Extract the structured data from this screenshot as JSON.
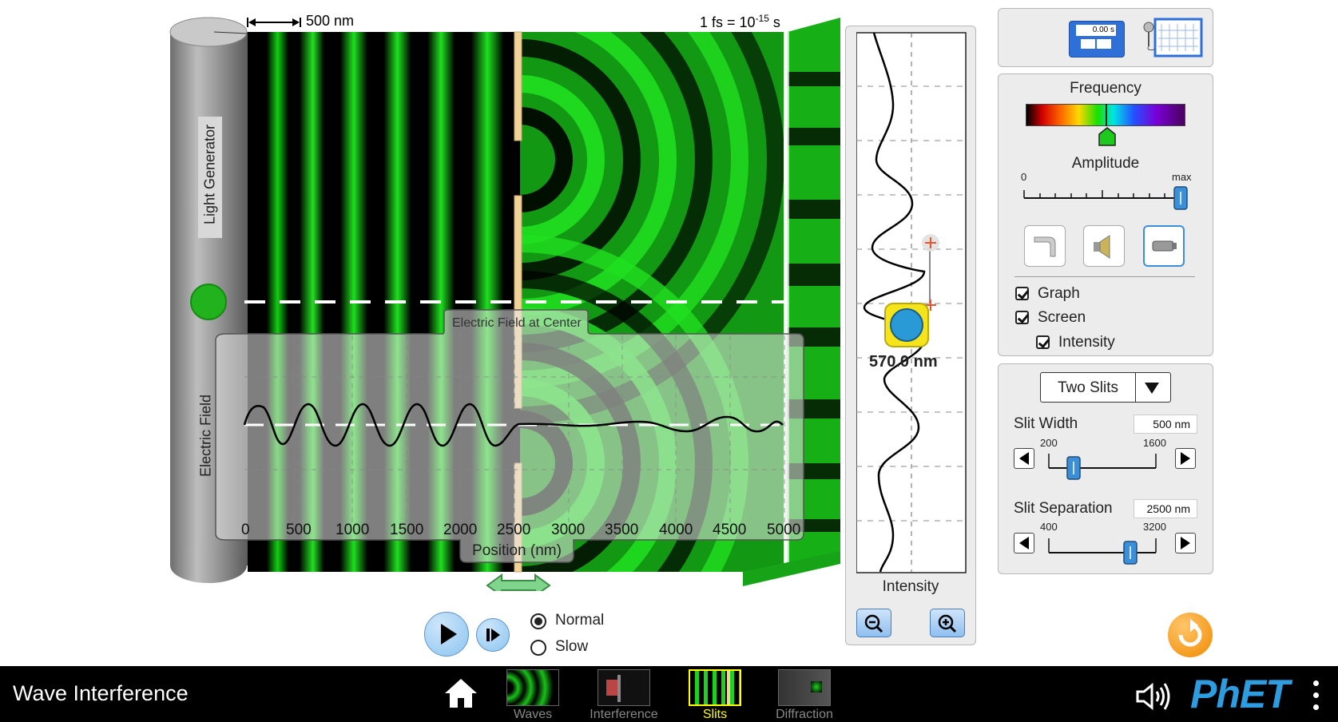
{
  "scale": {
    "length": "500 nm",
    "time_prefix": "1 fs = 10",
    "time_exp": "-15",
    "time_unit": " s"
  },
  "light_generator": {
    "label": "Light Generator"
  },
  "efield_chart": {
    "title": "Electric Field at Center",
    "ylabel": "Electric Field",
    "xlabel": "Position (nm)",
    "ticks": [
      "0",
      "500",
      "1000",
      "1500",
      "2000",
      "2500",
      "3000",
      "3500",
      "4000",
      "4500",
      "5000"
    ]
  },
  "intensity": {
    "label": "Intensity",
    "tape": "570.0 nm"
  },
  "tools": {
    "stopwatch_text": "0.00 s"
  },
  "frequency_panel": {
    "frequency": "Frequency",
    "amplitude": "Amplitude",
    "amp_min": "0",
    "amp_max": "max",
    "amplitude_level": 1.0,
    "frequency_level": 0.42,
    "graph": "Graph",
    "screen": "Screen",
    "intensity": "Intensity"
  },
  "slits_panel": {
    "selected": "Two Slits",
    "slit_width": {
      "label": "Slit Width",
      "value": "500 nm",
      "min": "200",
      "max": "1600",
      "level": 0.21
    },
    "slit_separation": {
      "label": "Slit Separation",
      "value": "2500 nm",
      "min": "400",
      "max": "3200",
      "level": 0.75
    }
  },
  "playback": {
    "normal": "Normal",
    "slow": "Slow"
  },
  "bottom": {
    "title": "Wave Interference",
    "screens": [
      "Waves",
      "Interference",
      "Slits",
      "Diffraction"
    ],
    "active": "Slits",
    "logo": "PhET"
  },
  "colors": {
    "wave": "#1fd51f",
    "active_tab": "#ffff00",
    "reset": "#f5a623",
    "button_blue": "#3b8fd8"
  }
}
